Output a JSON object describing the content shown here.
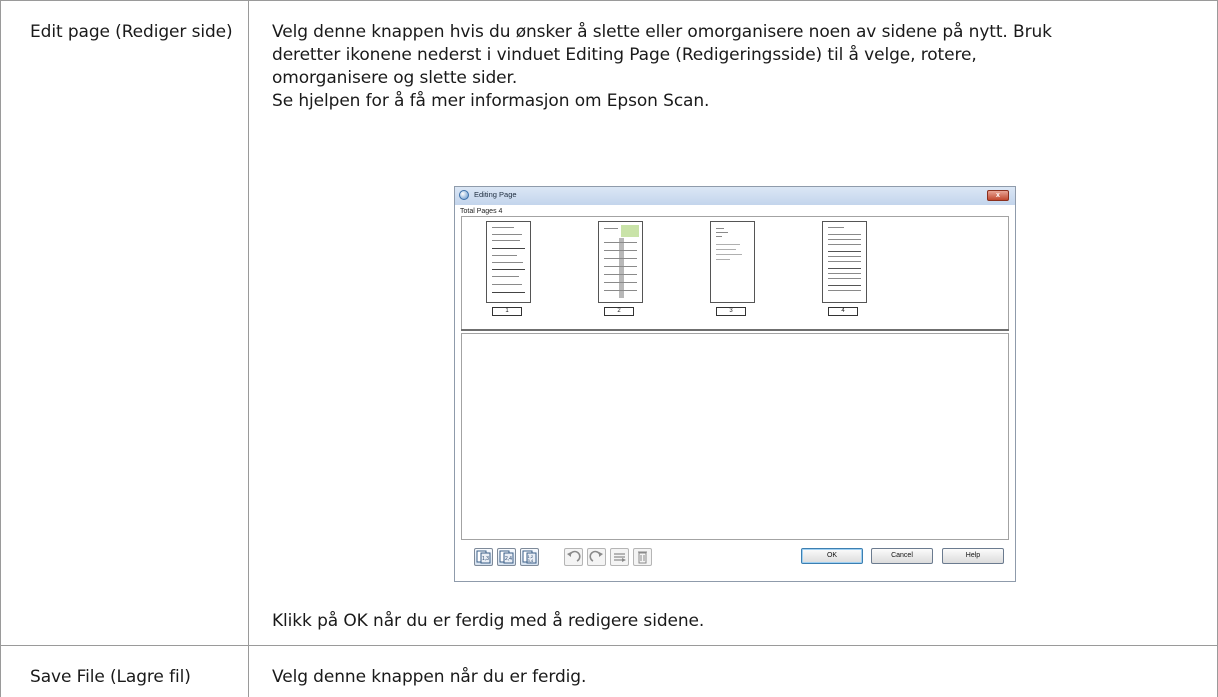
{
  "rows": [
    {
      "label": "Edit page (Rediger side)",
      "description_lines": [
        "Velg denne knappen hvis du ønsker å slette eller omorganisere noen av sidene på nytt. Bruk",
        "deretter ikonene nederst i vinduet Editing Page (Redigeringsside) til å velge, rotere,",
        "omorganisere og slette sider.",
        "Se hjelpen for å få mer informasjon om Epson Scan."
      ],
      "footer_text": "Klikk på OK når du er ferdig med å redigere sidene."
    },
    {
      "label": "Save File (Lagre fil)",
      "description": "Velg denne knappen når du er ferdig."
    }
  ],
  "dialog": {
    "title": "Editing Page",
    "close_glyph": "x",
    "total_pages": "Total Pages 4",
    "page_numbers": [
      "1",
      "2",
      "3",
      "4"
    ],
    "buttons": {
      "ok": "OK",
      "cancel": "Cancel",
      "help": "Help"
    },
    "tool_icons": [
      "select-odd-pages-icon",
      "select-even-pages-icon",
      "select-all-pages-icon",
      "rotate-left-icon",
      "rotate-right-icon",
      "reorder-pages-icon",
      "delete-page-icon"
    ],
    "colors": {
      "title_bar": "#c3d5ec",
      "close_button": "#c1482f",
      "frame": "#8f9bab"
    }
  }
}
